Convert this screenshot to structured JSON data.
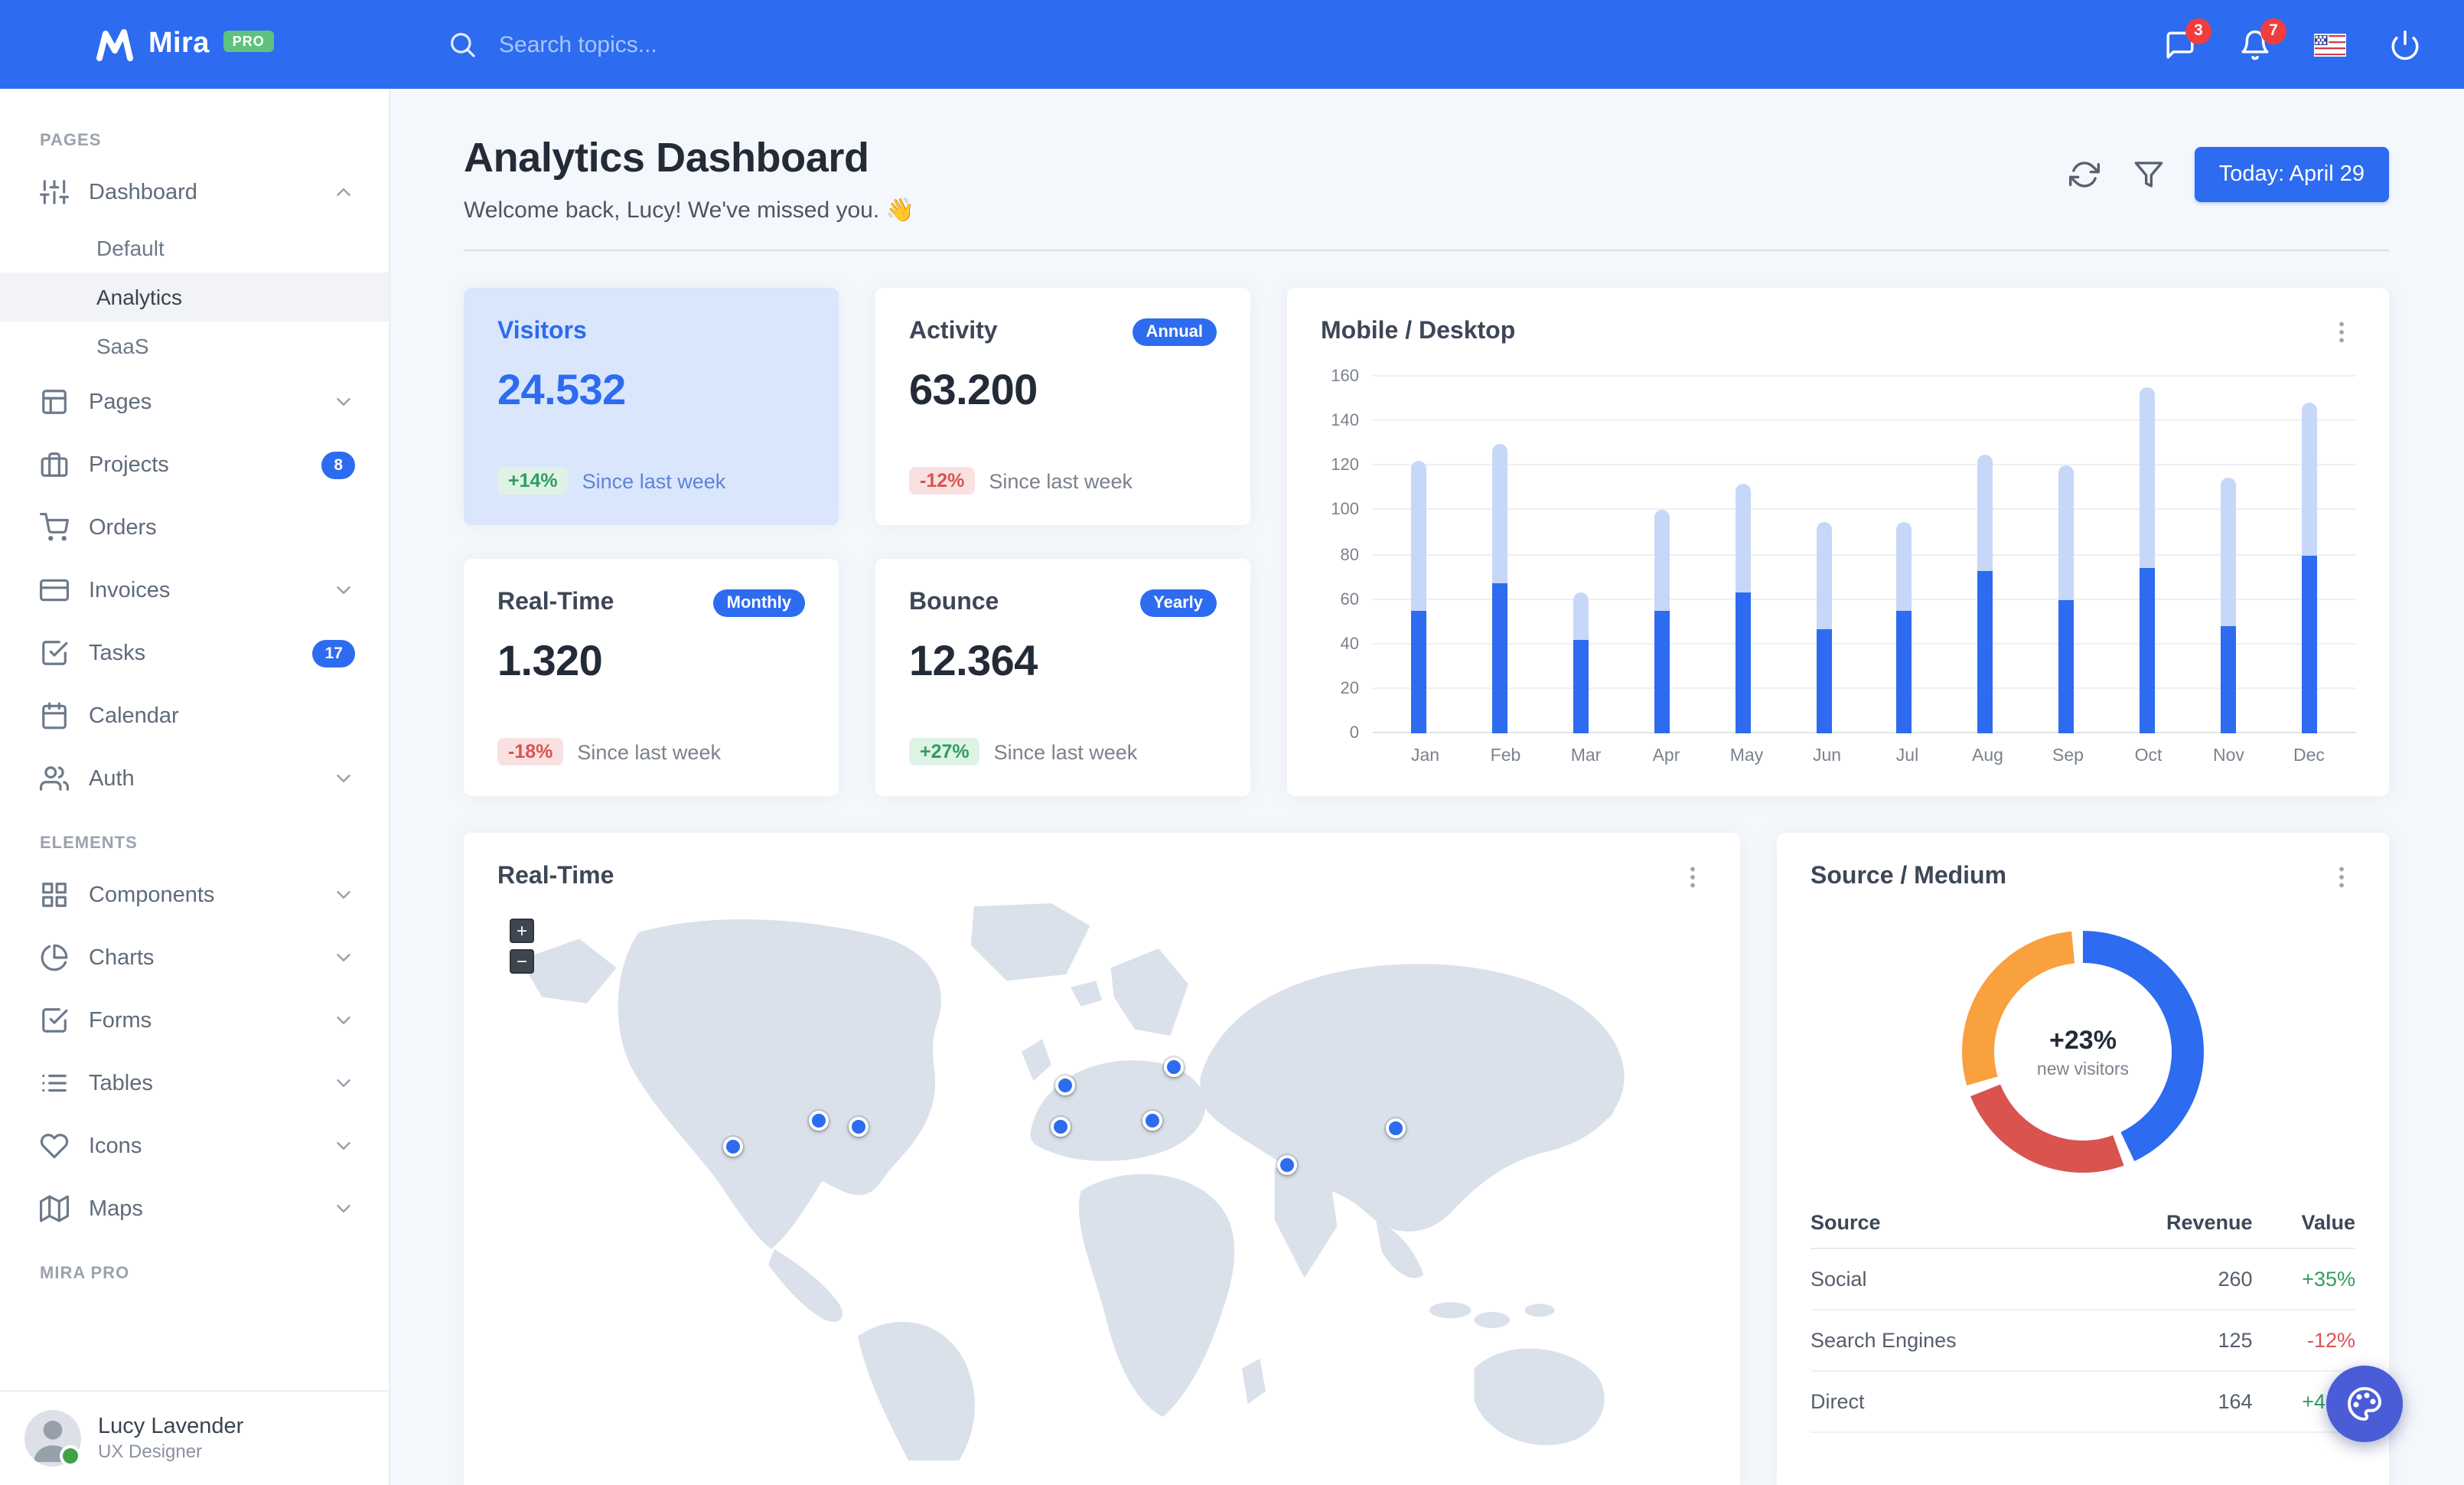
{
  "colors": {
    "primary": "#2d6bf0",
    "bar_mobile": "#2d6bf0",
    "bar_desktop": "#c7d7f8",
    "positive": "#2f9e5f",
    "negative": "#d9534f",
    "donut_blue": "#2d6bf0",
    "donut_red": "#d9534f",
    "donut_orange": "#f9a03f",
    "fab": "#4a5cd6",
    "notification_red": "#f03d3d",
    "pro_badge_green": "#5fc27e"
  },
  "topbar": {
    "brand": "Mira",
    "brand_badge": "PRO",
    "search_placeholder": "Search topics...",
    "messages_badge": "3",
    "alerts_badge": "7"
  },
  "sidebar": {
    "sections": [
      {
        "label": "PAGES",
        "items": [
          {
            "label": "Dashboard",
            "icon": "sliders",
            "expanded": true,
            "children": [
              {
                "label": "Default",
                "active": false
              },
              {
                "label": "Analytics",
                "active": true
              },
              {
                "label": "SaaS",
                "active": false
              }
            ]
          },
          {
            "label": "Pages",
            "icon": "layout",
            "chevron": true
          },
          {
            "label": "Projects",
            "icon": "briefcase",
            "badge": "8"
          },
          {
            "label": "Orders",
            "icon": "shopping-cart"
          },
          {
            "label": "Invoices",
            "icon": "credit-card",
            "chevron": true
          },
          {
            "label": "Tasks",
            "icon": "check-square",
            "badge": "17"
          },
          {
            "label": "Calendar",
            "icon": "calendar"
          },
          {
            "label": "Auth",
            "icon": "users",
            "chevron": true
          }
        ]
      },
      {
        "label": "ELEMENTS",
        "items": [
          {
            "label": "Components",
            "icon": "grid",
            "chevron": true
          },
          {
            "label": "Charts",
            "icon": "pie-chart",
            "chevron": true
          },
          {
            "label": "Forms",
            "icon": "check-square",
            "chevron": true
          },
          {
            "label": "Tables",
            "icon": "list",
            "chevron": true
          },
          {
            "label": "Icons",
            "icon": "heart",
            "chevron": true
          },
          {
            "label": "Maps",
            "icon": "map",
            "chevron": true
          }
        ]
      },
      {
        "label": "MIRA PRO",
        "items": []
      }
    ],
    "user": {
      "name": "Lucy Lavender",
      "role": "UX Designer"
    }
  },
  "header": {
    "title": "Analytics Dashboard",
    "subtitle": "Welcome back, Lucy! We've missed you. 👋",
    "date_button": "Today: April 29"
  },
  "stats": [
    {
      "title": "Visitors",
      "value": "24.532",
      "delta": "+14%",
      "delta_type": "positive",
      "caption": "Since last week",
      "highlight": true
    },
    {
      "title": "Activity",
      "badge": "Annual",
      "value": "63.200",
      "delta": "-12%",
      "delta_type": "negative",
      "caption": "Since last week"
    },
    {
      "title": "Real-Time",
      "badge": "Monthly",
      "value": "1.320",
      "delta": "-18%",
      "delta_type": "negative",
      "caption": "Since last week"
    },
    {
      "title": "Bounce",
      "badge": "Yearly",
      "value": "12.364",
      "delta": "+27%",
      "delta_type": "positive",
      "caption": "Since last week"
    }
  ],
  "chart_data": [
    {
      "type": "bar",
      "title": "Mobile / Desktop",
      "stacked": true,
      "categories": [
        "Jan",
        "Feb",
        "Mar",
        "Apr",
        "May",
        "Jun",
        "Jul",
        "Aug",
        "Sep",
        "Oct",
        "Nov",
        "Dec"
      ],
      "series": [
        {
          "name": "Mobile",
          "color": "#2d6bf0",
          "values": [
            55,
            67,
            42,
            55,
            63,
            47,
            55,
            73,
            60,
            74,
            48,
            80
          ]
        },
        {
          "name": "Desktop",
          "color": "#c7d7f8",
          "values": [
            67,
            63,
            21,
            45,
            49,
            48,
            40,
            52,
            60,
            81,
            67,
            68
          ]
        }
      ],
      "xlabel": "",
      "ylabel": "",
      "ylim": [
        0,
        160
      ],
      "ytick": 20,
      "grid": true,
      "legend": "none"
    },
    {
      "type": "donut",
      "title": "Source / Medium",
      "center_value": "+23%",
      "center_label": "new visitors",
      "segments": [
        {
          "name": "Social",
          "color": "#2d6bf0",
          "percent": 43
        },
        {
          "name": "Search Engines",
          "color": "#d9534f",
          "percent": 24.5
        },
        {
          "name": "Direct",
          "color": "#f9a03f",
          "percent": 28
        }
      ]
    }
  ],
  "map_card": {
    "title": "Real-Time",
    "zoom_in": "+",
    "zoom_out": "−",
    "markers": [
      {
        "x": 19.5,
        "y": 43.8
      },
      {
        "x": 26.6,
        "y": 39.1
      },
      {
        "x": 29.9,
        "y": 40.0
      },
      {
        "x": 46.6,
        "y": 40.0
      },
      {
        "x": 47.0,
        "y": 32.8
      },
      {
        "x": 54.2,
        "y": 39.1
      },
      {
        "x": 56.0,
        "y": 29.3
      },
      {
        "x": 65.3,
        "y": 47.0
      },
      {
        "x": 74.3,
        "y": 40.3
      }
    ]
  },
  "source_card": {
    "title": "Source / Medium",
    "table": {
      "headers": [
        "Source",
        "Revenue",
        "Value"
      ],
      "rows": [
        {
          "source": "Social",
          "revenue": "260",
          "value": "+35%",
          "value_type": "positive"
        },
        {
          "source": "Search Engines",
          "revenue": "125",
          "value": "-12%",
          "value_type": "negative"
        },
        {
          "source": "Direct",
          "revenue": "164",
          "value": "+46%",
          "value_type": "positive"
        }
      ]
    }
  }
}
